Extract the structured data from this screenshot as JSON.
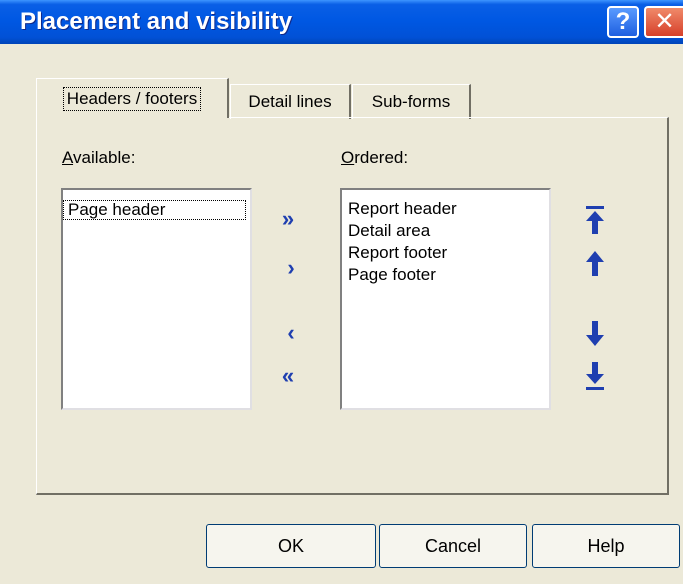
{
  "window": {
    "title": "Placement and visibility",
    "help_glyph": "?",
    "close_glyph": "✕"
  },
  "tabs": [
    {
      "label": "Headers / footers",
      "active": true
    },
    {
      "label": "Detail lines",
      "active": false
    },
    {
      "label": "Sub-forms",
      "active": false
    }
  ],
  "available": {
    "label_mnemonic": "A",
    "label_rest": "vailable:",
    "items": [
      "Page header"
    ]
  },
  "ordered": {
    "label_mnemonic": "O",
    "label_rest": "rdered:",
    "items": [
      "Report header",
      "Detail area",
      "Report footer",
      "Page footer"
    ]
  },
  "move_buttons": {
    "all_right": "»",
    "right": "›",
    "left": "‹",
    "all_left": "«"
  },
  "order_buttons": [
    "move-to-top-icon",
    "move-up-icon",
    "move-down-icon",
    "move-to-bottom-icon"
  ],
  "buttons": {
    "ok": "OK",
    "cancel": "Cancel",
    "help": "Help"
  },
  "colors": {
    "titlebar": "#0058e3",
    "dialog_bg": "#ece9d8",
    "arrow": "#1f3fb0"
  }
}
